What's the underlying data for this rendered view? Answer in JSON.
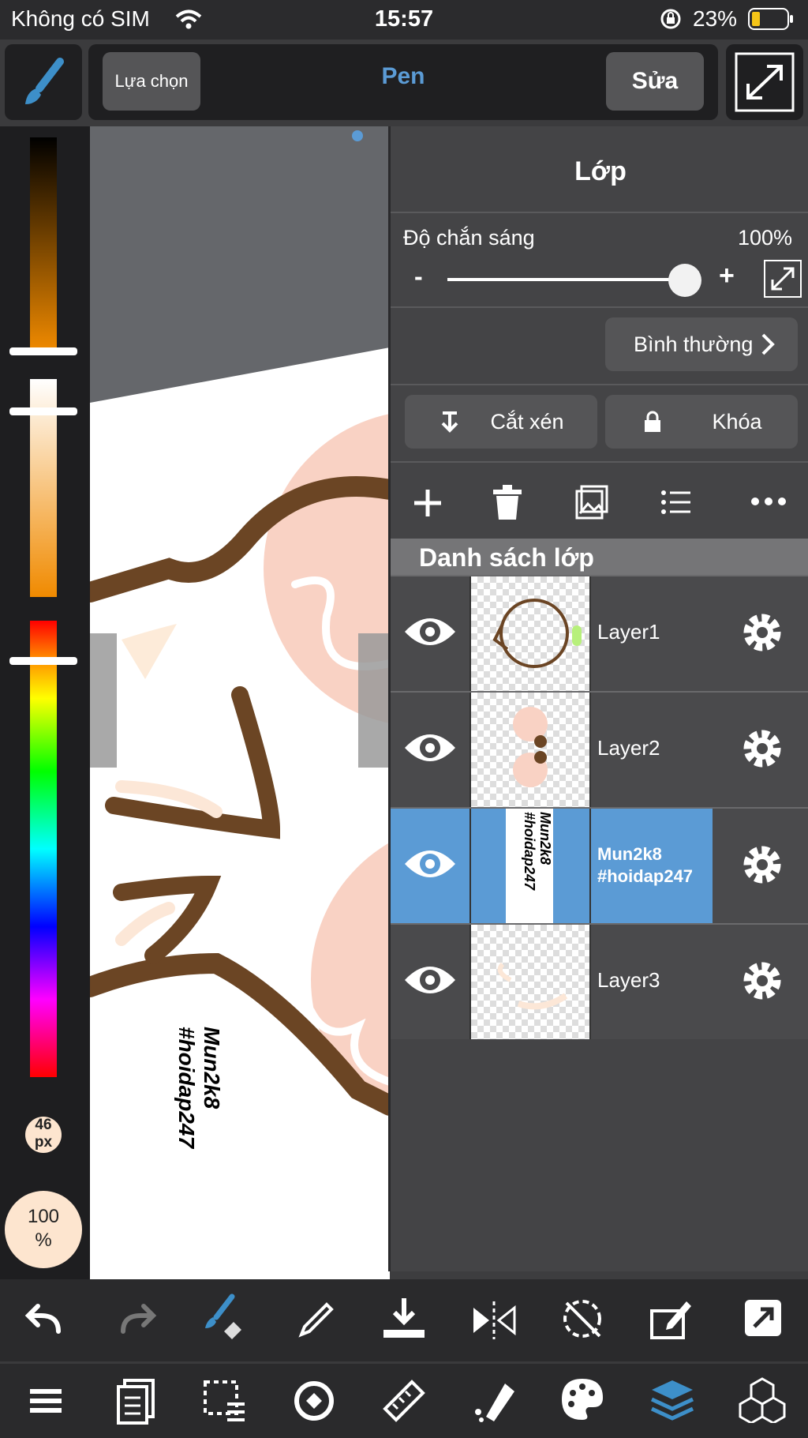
{
  "status_bar": {
    "carrier": "Không có SIM",
    "time": "15:57",
    "battery": "23%"
  },
  "top_bar": {
    "select_label": "Lựa chọn",
    "tool_name": "Pen",
    "edit_label": "Sửa"
  },
  "left_strip": {
    "brush_size": "46\npx",
    "opacity": "100\n%"
  },
  "canvas": {
    "watermark": "Mun2k8\n#hoidap247"
  },
  "layer_panel": {
    "title": "Lớp",
    "opacity_label": "Độ chắn sáng",
    "opacity_value": "100%",
    "minus": "-",
    "plus": "+",
    "blend_mode": "Bình thường",
    "clip_label": "Cắt xén",
    "lock_label": "Khóa",
    "list_header": "Danh sách lớp",
    "layers": [
      {
        "name": "Layer1",
        "selected": false
      },
      {
        "name": "Layer2",
        "selected": false
      },
      {
        "name": "Mun2k8\n#hoidap247",
        "selected": true
      },
      {
        "name": "Layer3",
        "selected": false
      }
    ],
    "thumb_text": "Mun2k8\n#hoidap247"
  },
  "colors": {
    "accent": "#5b9bd5",
    "panel": "#444446",
    "selected_row": "#5b9bd5",
    "skin": "#f9d2c4",
    "brown": "#6b4524"
  }
}
